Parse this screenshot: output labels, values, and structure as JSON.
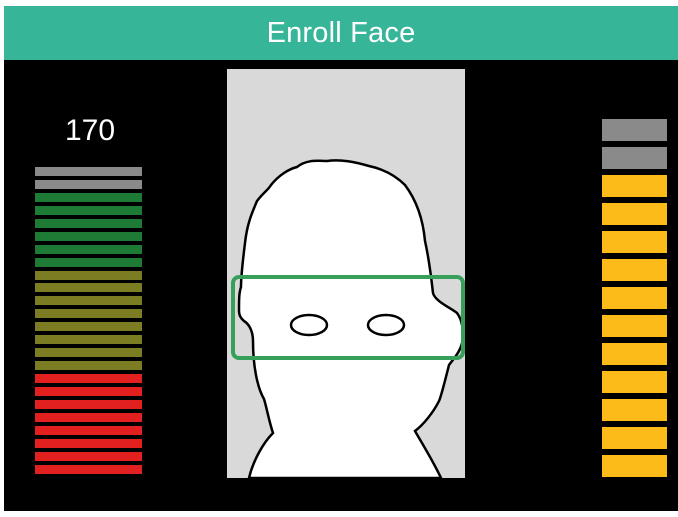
{
  "header": {
    "title": "Enroll Face"
  },
  "reading": {
    "value": "170"
  },
  "left_meter": {
    "bars": [
      {
        "state": "off",
        "color": "#8a8a8a"
      },
      {
        "state": "off",
        "color": "#8a8a8a"
      },
      {
        "state": "good",
        "color": "#1e7b36"
      },
      {
        "state": "good",
        "color": "#1e7b36"
      },
      {
        "state": "good",
        "color": "#1e7b36"
      },
      {
        "state": "good",
        "color": "#1e7b36"
      },
      {
        "state": "good",
        "color": "#1e7b36"
      },
      {
        "state": "good",
        "color": "#1e7b36"
      },
      {
        "state": "fair",
        "color": "#7c7d22"
      },
      {
        "state": "fair",
        "color": "#7c7d22"
      },
      {
        "state": "fair",
        "color": "#7c7d22"
      },
      {
        "state": "fair",
        "color": "#7c7d22"
      },
      {
        "state": "fair",
        "color": "#7c7d22"
      },
      {
        "state": "fair",
        "color": "#7c7d22"
      },
      {
        "state": "fair",
        "color": "#7c7d22"
      },
      {
        "state": "fair",
        "color": "#7c7d22"
      },
      {
        "state": "poor",
        "color": "#e2201f"
      },
      {
        "state": "poor",
        "color": "#e2201f"
      },
      {
        "state": "poor",
        "color": "#e2201f"
      },
      {
        "state": "poor",
        "color": "#e2201f"
      },
      {
        "state": "poor",
        "color": "#e2201f"
      },
      {
        "state": "poor",
        "color": "#e2201f"
      },
      {
        "state": "poor",
        "color": "#e2201f"
      },
      {
        "state": "poor",
        "color": "#e2201f"
      }
    ]
  },
  "right_meter": {
    "segments": [
      {
        "state": "off",
        "color": "#8a8a8a"
      },
      {
        "state": "off",
        "color": "#8a8a8a"
      },
      {
        "state": "on",
        "color": "#fdbb1a"
      },
      {
        "state": "on",
        "color": "#fdbb1a"
      },
      {
        "state": "on",
        "color": "#fdbb1a"
      },
      {
        "state": "on",
        "color": "#fdbb1a"
      },
      {
        "state": "on",
        "color": "#fdbb1a"
      },
      {
        "state": "on",
        "color": "#fdbb1a"
      },
      {
        "state": "on",
        "color": "#fdbb1a"
      },
      {
        "state": "on",
        "color": "#fdbb1a"
      },
      {
        "state": "on",
        "color": "#fdbb1a"
      },
      {
        "state": "on",
        "color": "#fdbb1a"
      },
      {
        "state": "on",
        "color": "#fdbb1a"
      }
    ]
  },
  "colors": {
    "header": "#36b598",
    "eye_box": "#36a05a",
    "camera_background": "#d9d9d9"
  }
}
